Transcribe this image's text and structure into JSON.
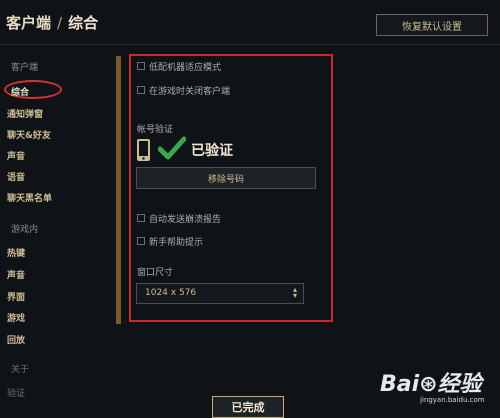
{
  "header": {
    "breadcrumb_root": "客户端",
    "separator": "/",
    "breadcrumb_current": "综合",
    "restore_defaults_label": "恢复默认设置"
  },
  "sidebar": {
    "client_header": "客户端",
    "client_items": [
      "综合",
      "通知弹窗",
      "聊天&好友",
      "声音",
      "语音",
      "聊天黑名单"
    ],
    "ingame_header": "游戏内",
    "ingame_items": [
      "热键",
      "声音",
      "界面",
      "游戏",
      "回放"
    ],
    "about_header": "关于",
    "about_items": [
      "验证"
    ]
  },
  "general": {
    "low_spec_mode": "低配机器适应模式",
    "close_client_in_game": "在游戏时关闭客户端",
    "account_verify_label": "帐号验证",
    "verified_text": "已验证",
    "remove_number_label": "移除号码",
    "auto_send_crash": "自动发送崩溃报告",
    "newbie_help_tips": "新手帮助提示",
    "window_size_label": "窗口尺寸",
    "window_size_value": "1024 x 576"
  },
  "footer": {
    "done_label": "已完成"
  },
  "watermark": {
    "brand": "Bai⊛经验",
    "url": "jingyan.baidu.com"
  },
  "colors": {
    "accent_gold": "#c8aa6e",
    "verified_green": "#3aa84a",
    "highlight_red": "#cc2a2a"
  }
}
